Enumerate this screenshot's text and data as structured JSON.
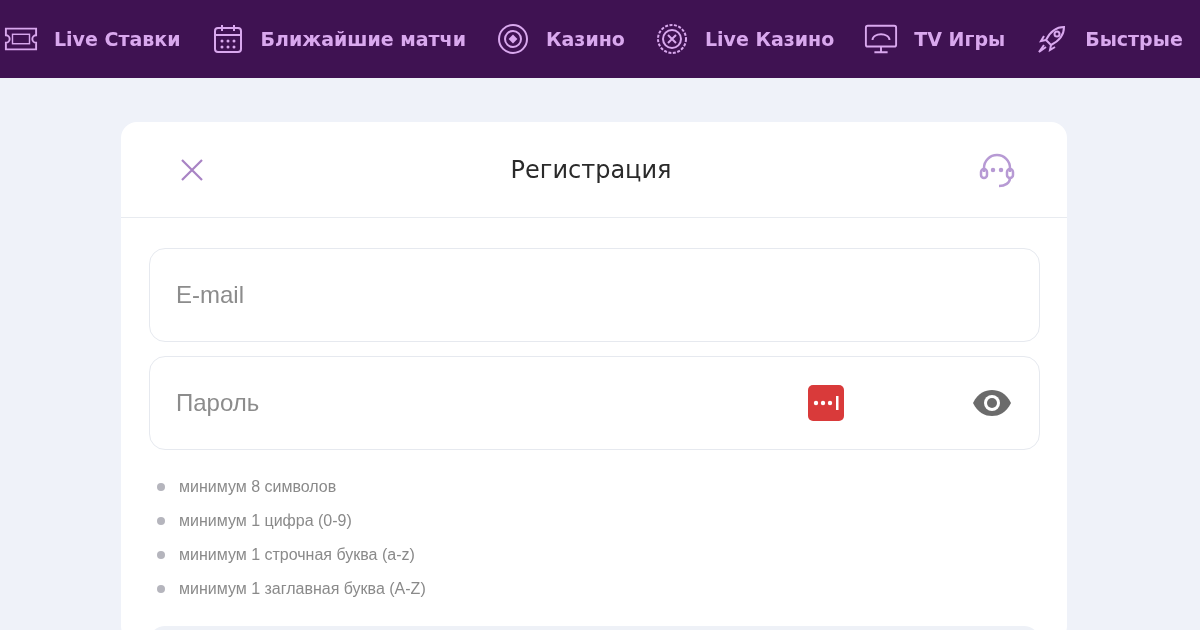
{
  "nav": [
    {
      "label": "Live Ставки"
    },
    {
      "label": "Ближайшие матчи"
    },
    {
      "label": "Казино"
    },
    {
      "label": "Live Казино"
    },
    {
      "label": "TV Игры"
    },
    {
      "label": "Быстрые"
    }
  ],
  "dialog": {
    "title": "Регистрация"
  },
  "fields": [
    {
      "kind": "text",
      "placeholder": "E-mail"
    },
    {
      "kind": "password",
      "placeholder": "Пароль"
    }
  ],
  "requirements": [
    "минимум 8 символов",
    "минимум 1 цифра (0-9)",
    "минимум 1 строчная буква (a-z)",
    "минимум 1 заглавная буква (A-Z)"
  ]
}
